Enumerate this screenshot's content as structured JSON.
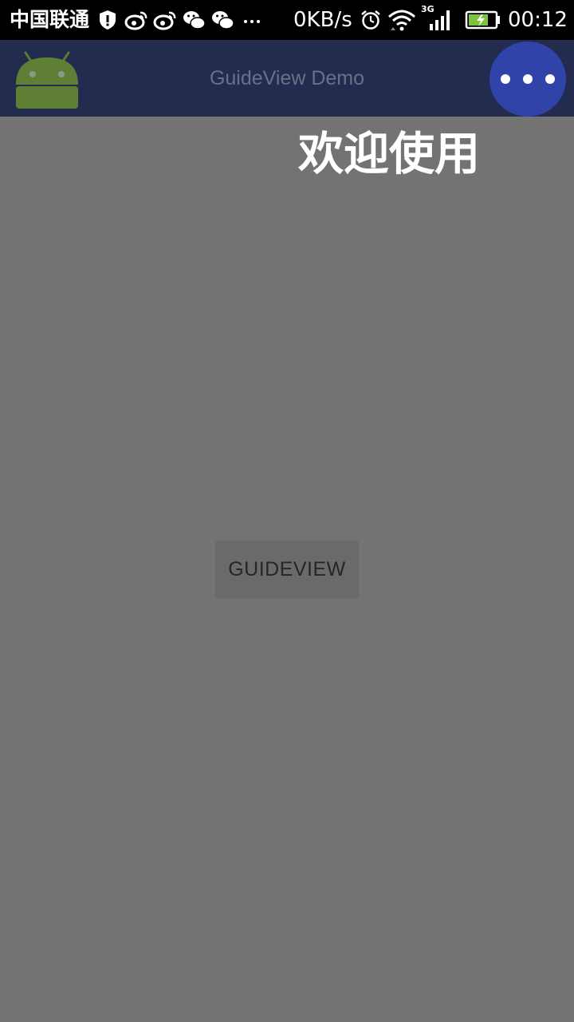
{
  "status_bar": {
    "carrier": "中国联通",
    "notification_icons": [
      "shield-icon",
      "weibo-icon",
      "weibo-icon",
      "wechat-icon",
      "wechat-icon",
      "more-icon"
    ],
    "network_speed": "0KB/s",
    "network_type": "3G",
    "time": "00:12",
    "battery_color": "#7ec242"
  },
  "action_bar": {
    "title": "GuideView Demo",
    "logo_icon": "android-icon",
    "overflow_icon": "more-dots-icon",
    "background": "#232b4f",
    "overflow_highlight": "#2f43a8"
  },
  "overlay": {
    "welcome_text": "欢迎使用"
  },
  "main": {
    "guide_button_label": "GUIDEVIEW"
  }
}
